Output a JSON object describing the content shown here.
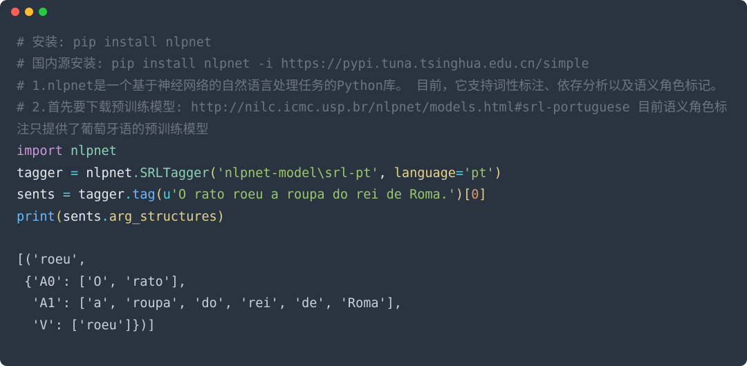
{
  "window": {
    "traffic_light_colors": [
      "#ff5f57",
      "#febc2e",
      "#28c840"
    ]
  },
  "code": {
    "c1_full": "# 安装: pip install nlpnet",
    "c2_full": "# 国内源安装: pip install nlpnet -i https://pypi.tuna.tsinghua.edu.cn/simple",
    "c3_full": "# 1.nlpnet是一个基于神经网络的自然语言处理任务的Python库。 目前，它支持词性标注、依存分析以及语义角色标记。",
    "c4_full": "# 2.首先要下载预训练模型: http://nilc.icmc.usp.br/nlpnet/models.html#srl-portuguese 目前语义角色标注只提供了葡萄牙语的预训练模型",
    "kw_import": "import",
    "mod_nlpnet": "nlpnet",
    "id_tagger": "tagger",
    "eq": " = ",
    "nlpnet_name": "nlpnet",
    "dot": ".",
    "cls_srltagger": "SRLTagger",
    "lp": "(",
    "srl_arg1": "'nlpnet-model\\srl-pt'",
    "comma_sp": ", ",
    "kw_language": "language",
    "lang_val": "'pt'",
    "rp": ")",
    "id_sents": "sents",
    "tagger_name": "tagger",
    "fn_tag": "tag",
    "u_prefix": "u",
    "sentence": "'O rato roeu a roupa do rei de Roma.'",
    "idx_open": "[",
    "idx0": "0",
    "idx_close": "]",
    "fn_print": "print",
    "attr_arg": "arg_structures",
    "out_l1": "[('roeu',",
    "out_l2": " {'A0': ['O', 'rato'],",
    "out_l3": "  'A1': ['a', 'roupa', 'do', 'rei', 'de', 'Roma'],",
    "out_l4": "  'V': ['roeu']})]"
  }
}
